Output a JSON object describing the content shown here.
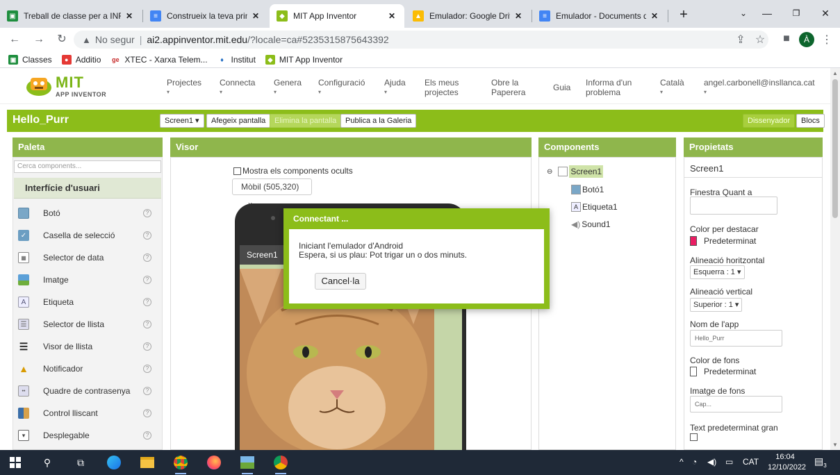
{
  "browser": {
    "tabs": [
      {
        "title": "Treball de classe per a INF",
        "icon": "classroom-icon",
        "color": "#1e8e3e",
        "active": false
      },
      {
        "title": "Construeix la teva primera",
        "icon": "docs-icon",
        "color": "#4285f4",
        "active": false
      },
      {
        "title": "MIT App Inventor",
        "icon": "app-inventor-icon",
        "color": "#8cbd1a",
        "active": true
      },
      {
        "title": "Emulador: Google Drive",
        "icon": "drive-icon",
        "color": "#fbbc04",
        "active": false
      },
      {
        "title": "Emulador - Documents de",
        "icon": "docs-icon",
        "color": "#4285f4",
        "active": false
      }
    ],
    "new_tab": "+",
    "address": {
      "security": "No segur",
      "host": "ai2.appinventor.mit.edu",
      "path": "/?locale=ca#5235315875643392"
    },
    "profile_initial": "À",
    "bookmarks": [
      {
        "label": "Classes",
        "icon": "classroom-icon",
        "color": "#1e8e3e"
      },
      {
        "label": "Additio",
        "icon": "additio-icon",
        "color": "#e53935"
      },
      {
        "label": "XTEC - Xarxa Telem...",
        "icon": "gencat-icon",
        "color": "#c62828"
      },
      {
        "label": "Institut",
        "icon": "institut-icon",
        "color": "#1565c0"
      },
      {
        "label": "MIT App Inventor",
        "icon": "app-inventor-icon",
        "color": "#8cbd1a"
      }
    ]
  },
  "app": {
    "logo": {
      "mit": "MIT",
      "sub": "APP INVENTOR"
    },
    "menu": [
      {
        "label": "Projectes",
        "caret": true
      },
      {
        "label": "Connecta",
        "caret": true
      },
      {
        "label": "Genera",
        "caret": true
      },
      {
        "label": "Configuració",
        "caret": true
      },
      {
        "label": "Ajuda",
        "caret": true
      },
      {
        "label": "Els meus projectes",
        "caret": false
      },
      {
        "label": "Obre la Paperera",
        "caret": false
      },
      {
        "label": "Guia",
        "caret": false
      },
      {
        "label": "Informa d'un problema",
        "caret": false
      },
      {
        "label": "Català",
        "caret": true
      },
      {
        "label": "angel.carbonell@insllanca.cat",
        "caret": true
      }
    ],
    "project_name": "Hello_Purr",
    "toolbar": {
      "screen": "Screen1 ▾",
      "add_screen": "Afegeix pantalla",
      "remove_screen": "Elimina la pantalla",
      "publish": "Publica a la Galeria",
      "designer": "Dissenyador",
      "blocks": "Blocs"
    },
    "palette": {
      "title": "Paleta",
      "search_placeholder": "Cerca components...",
      "category": "Interfície d'usuari",
      "items": [
        {
          "label": "Botó",
          "icon": "button-icon"
        },
        {
          "label": "Casella de selecció",
          "icon": "checkbox-icon"
        },
        {
          "label": "Selector de data",
          "icon": "calendar-icon"
        },
        {
          "label": "Imatge",
          "icon": "image-icon"
        },
        {
          "label": "Etiqueta",
          "icon": "label-icon"
        },
        {
          "label": "Selector de llista",
          "icon": "list-picker-icon"
        },
        {
          "label": "Visor de llista",
          "icon": "list-view-icon"
        },
        {
          "label": "Notificador",
          "icon": "warning-icon"
        },
        {
          "label": "Quadre de contrasenya",
          "icon": "password-icon"
        },
        {
          "label": "Control lliscant",
          "icon": "slider-icon"
        },
        {
          "label": "Desplegable",
          "icon": "spinner-icon"
        }
      ],
      "help": "?"
    },
    "viewer": {
      "title": "Visor",
      "show_hidden": "Mostra els components ocults",
      "device": "Mòbil (505,320)",
      "screen_title": "Screen1"
    },
    "components": {
      "title": "Components",
      "items": [
        {
          "label": "Screen1",
          "icon": "screen-icon"
        },
        {
          "label": "Botó1",
          "icon": "button-icon"
        },
        {
          "label": "Etiqueta1",
          "icon": "label-icon"
        },
        {
          "label": "Sound1",
          "icon": "sound-icon"
        }
      ]
    },
    "properties": {
      "title": "Propietats",
      "component": "Screen1",
      "about_label": "Finestra Quant a",
      "accent_label": "Color per destacar",
      "accent_value": "Predeterminat",
      "accent_color": "#e91e63",
      "halign_label": "Alineació horitzontal",
      "halign_value": "Esquerra : 1 ▾",
      "valign_label": "Alineació vertical",
      "valign_value": "Superior : 1 ▾",
      "appname_label": "Nom de l'app",
      "appname_value": "Hello_Purr",
      "bg_label": "Color de fons",
      "bg_value": "Predeterminat",
      "bgimg_label": "Imatge de fons",
      "bgimg_value": "Cap...",
      "bigtext_label": "Text predeterminat gran"
    },
    "dialog": {
      "title": "Connectant ...",
      "line1": "Iniciant l'emulador d'Android",
      "line2": "Espera, si us plau: Pot trigar un o dos minuts.",
      "cancel": "Cancel·la"
    }
  },
  "taskbar": {
    "lang": "CAT",
    "time": "16:04",
    "date": "12/10/2022",
    "notifications": "3"
  }
}
